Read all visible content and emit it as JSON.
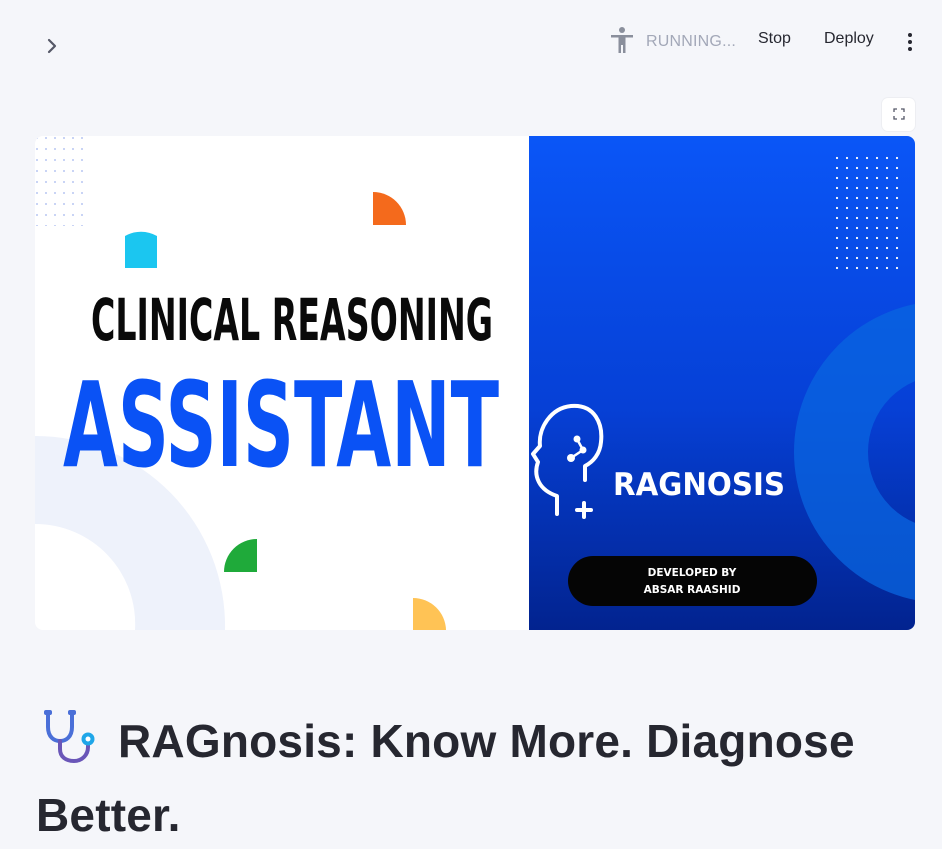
{
  "topbar": {
    "status_text": "RUNNING...",
    "stop_label": "Stop",
    "deploy_label": "Deploy",
    "icons": {
      "sidebar_toggle": "chevron-right-icon",
      "status": "running-person-icon",
      "menu": "more-vertical-icon",
      "fullscreen": "fullscreen-icon"
    }
  },
  "banner": {
    "headline": "CLINICAL REASONING",
    "subheadline": "ASSISTANT",
    "brand": "RAGNOSIS",
    "credit_line1": "DEVELOPED BY",
    "credit_line2": "ABSAR RAASHID",
    "colors": {
      "accent_blue": "#0a52f5",
      "panel_blue": "#0043d8",
      "orange": "#f46a1c",
      "cyan": "#1bc6f0",
      "green": "#1faa3a",
      "yellow": "#ffc355"
    }
  },
  "page": {
    "title": "RAGnosis: Know More. Diagnose Better.",
    "title_icon": "stethoscope-icon"
  }
}
